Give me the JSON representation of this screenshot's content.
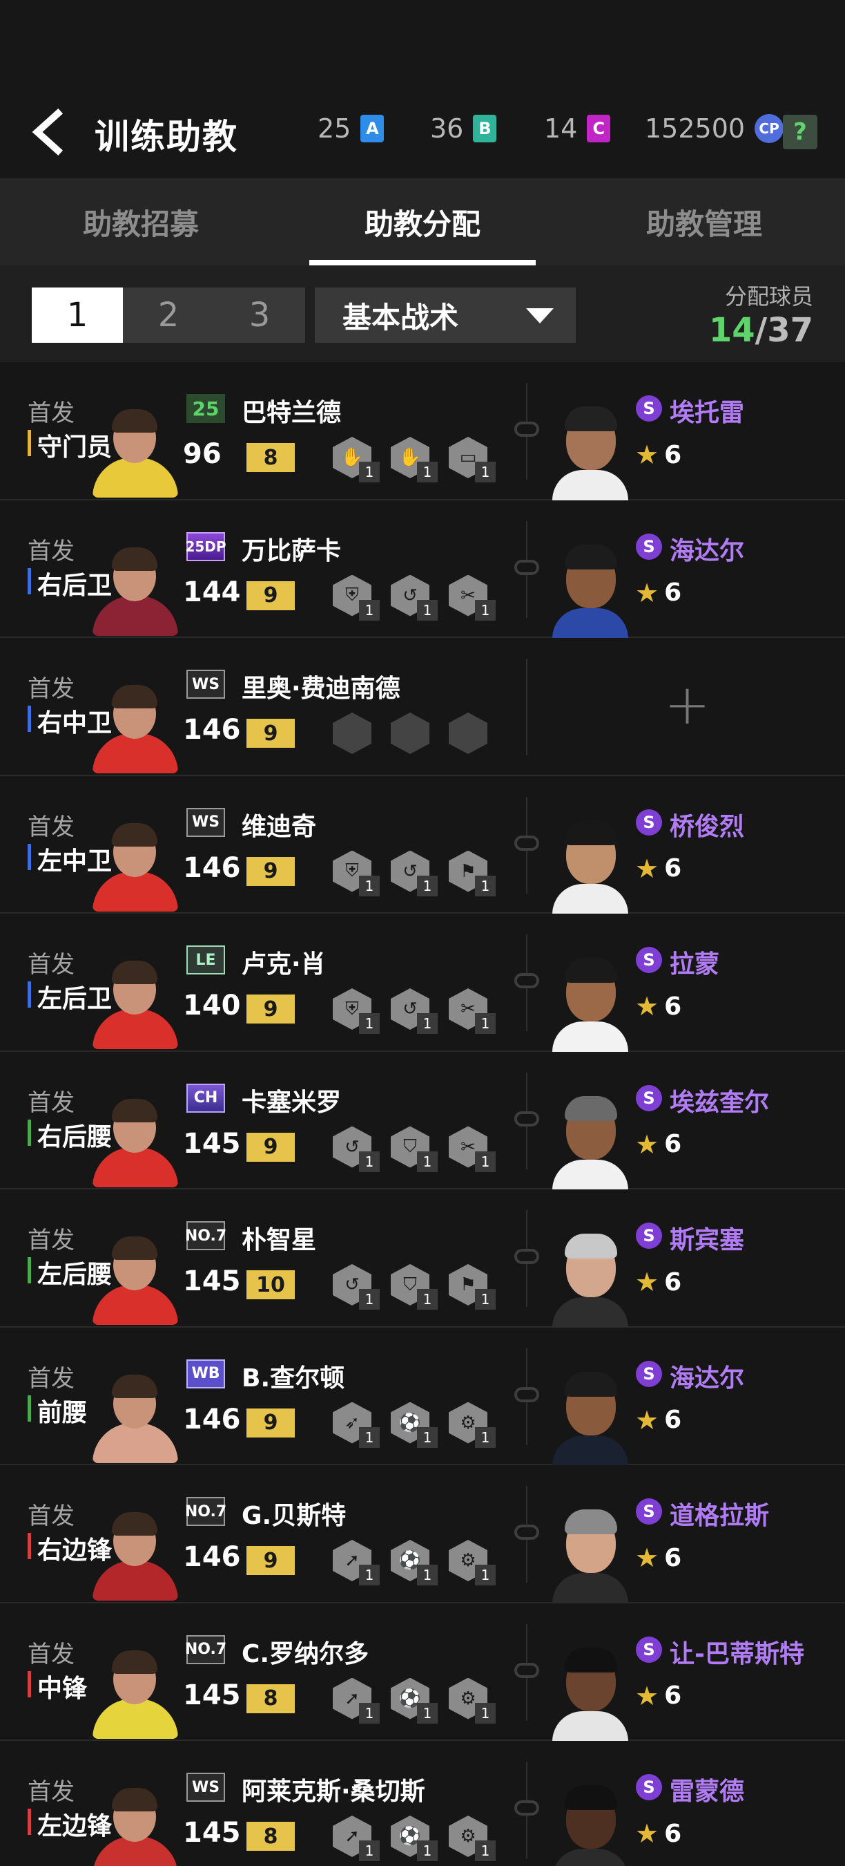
{
  "header": {
    "title": "训练助教",
    "currencies": [
      {
        "value": "25",
        "badge": "A",
        "color": "#2e8de8"
      },
      {
        "value": "36",
        "badge": "B",
        "color": "#2fb39a"
      },
      {
        "value": "14",
        "badge": "C",
        "color": "#c125c6"
      },
      {
        "value": "152500",
        "badge": "CP",
        "color": "#4f6ddd"
      }
    ],
    "help": "?"
  },
  "tabs": [
    {
      "label": "助教招募",
      "active": false
    },
    {
      "label": "助教分配",
      "active": true
    },
    {
      "label": "助教管理",
      "active": false
    }
  ],
  "controls": {
    "segments": [
      "1",
      "2",
      "3"
    ],
    "active_segment": "1",
    "dropdown": "基本战术",
    "assign_label": "分配球员",
    "assigned": "14",
    "total": "/37"
  },
  "rows": [
    {
      "status": "首发",
      "position": "守门员",
      "pos_color": "#e2b43b",
      "badge": "25",
      "badge_style": "green",
      "player": "巴特兰德",
      "rating": "96",
      "level": "8",
      "skills": [
        {
          "icon": "glove-icon",
          "glyph": "✋",
          "num": "1"
        },
        {
          "icon": "hand-icon",
          "glyph": "✋",
          "num": "1"
        },
        {
          "icon": "goal-icon",
          "glyph": "▭",
          "num": "1"
        }
      ],
      "coach": {
        "name": "埃托雷",
        "stars": "6",
        "tier": "S"
      }
    },
    {
      "status": "首发",
      "position": "右后卫",
      "pos_color": "#3e6fe0",
      "badge": "25DP",
      "badge_style": "purple",
      "player": "万比萨卡",
      "rating": "144",
      "level": "9",
      "skills": [
        {
          "icon": "shield-icon",
          "glyph": "⛨",
          "num": "1"
        },
        {
          "icon": "curve-icon",
          "glyph": "↺",
          "num": "1"
        },
        {
          "icon": "tackle-icon",
          "glyph": "✂",
          "num": "1"
        }
      ],
      "coach": {
        "name": "海达尔",
        "stars": "6",
        "tier": "S"
      }
    },
    {
      "status": "首发",
      "position": "右中卫",
      "pos_color": "#3e6fe0",
      "badge": "WS",
      "badge_style": "",
      "player": "里奥·费迪南德",
      "rating": "146",
      "level": "9",
      "skills": [
        {
          "icon": "empty-slot-icon",
          "glyph": "",
          "num": ""
        },
        {
          "icon": "empty-slot-icon",
          "glyph": "",
          "num": ""
        },
        {
          "icon": "empty-slot-icon",
          "glyph": "",
          "num": ""
        }
      ],
      "coach": null,
      "add": "+"
    },
    {
      "status": "首发",
      "position": "左中卫",
      "pos_color": "#3e6fe0",
      "badge": "WS",
      "badge_style": "",
      "player": "维迪奇",
      "rating": "146",
      "level": "9",
      "skills": [
        {
          "icon": "shield-icon",
          "glyph": "⛨",
          "num": "1"
        },
        {
          "icon": "curve-icon",
          "glyph": "↺",
          "num": "1"
        },
        {
          "icon": "header-icon",
          "glyph": "⚑",
          "num": "1"
        }
      ],
      "coach": {
        "name": "桥俊烈",
        "stars": "6",
        "tier": "S"
      }
    },
    {
      "status": "首发",
      "position": "左后卫",
      "pos_color": "#3e6fe0",
      "badge": "LE",
      "badge_style": "le",
      "player": "卢克·肖",
      "rating": "140",
      "level": "9",
      "skills": [
        {
          "icon": "shield-icon",
          "glyph": "⛨",
          "num": "1"
        },
        {
          "icon": "curve-icon",
          "glyph": "↺",
          "num": "1"
        },
        {
          "icon": "tackle-icon",
          "glyph": "✂",
          "num": "1"
        }
      ],
      "coach": {
        "name": "拉蒙",
        "stars": "6",
        "tier": "S"
      }
    },
    {
      "status": "首发",
      "position": "右后腰",
      "pos_color": "#4caa4e",
      "badge": "CH",
      "badge_style": "ch",
      "player": "卡塞米罗",
      "rating": "145",
      "level": "9",
      "skills": [
        {
          "icon": "curve-icon",
          "glyph": "↺",
          "num": "1"
        },
        {
          "icon": "defend-icon",
          "glyph": "⛉",
          "num": "1"
        },
        {
          "icon": "tackle-icon",
          "glyph": "✂",
          "num": "1"
        }
      ],
      "coach": {
        "name": "埃兹奎尔",
        "stars": "6",
        "tier": "S"
      }
    },
    {
      "status": "首发",
      "position": "左后腰",
      "pos_color": "#4caa4e",
      "badge": "NO.7",
      "badge_style": "",
      "player": "朴智星",
      "rating": "145",
      "level": "10",
      "skills": [
        {
          "icon": "curve-icon",
          "glyph": "↺",
          "num": "1"
        },
        {
          "icon": "defend-icon",
          "glyph": "⛉",
          "num": "1"
        },
        {
          "icon": "header-icon",
          "glyph": "⚑",
          "num": "1"
        }
      ],
      "coach": {
        "name": "斯宾塞",
        "stars": "6",
        "tier": "S"
      }
    },
    {
      "status": "首发",
      "position": "前腰",
      "pos_color": "#4caa4e",
      "badge": "WB",
      "badge_style": "wb",
      "player": "B.查尔顿",
      "rating": "146",
      "level": "9",
      "skills": [
        {
          "icon": "kick-icon",
          "glyph": "➶",
          "num": "1"
        },
        {
          "icon": "dribble-icon",
          "glyph": "⚽",
          "num": "1"
        },
        {
          "icon": "finish-icon",
          "glyph": "⚙",
          "num": "1"
        }
      ],
      "coach": {
        "name": "海达尔",
        "stars": "6",
        "tier": "S"
      }
    },
    {
      "status": "首发",
      "position": "右边锋",
      "pos_color": "#d64040",
      "badge": "NO.7",
      "badge_style": "",
      "player": "G.贝斯特",
      "rating": "146",
      "level": "9",
      "skills": [
        {
          "icon": "run-icon",
          "glyph": "➚",
          "num": "1"
        },
        {
          "icon": "dribble-icon",
          "glyph": "⚽",
          "num": "1"
        },
        {
          "icon": "finish-icon",
          "glyph": "⚙",
          "num": "1"
        }
      ],
      "coach": {
        "name": "道格拉斯",
        "stars": "6",
        "tier": "S"
      }
    },
    {
      "status": "首发",
      "position": "中锋",
      "pos_color": "#d64040",
      "badge": "NO.7",
      "badge_style": "",
      "player": "C.罗纳尔多",
      "rating": "145",
      "level": "8",
      "skills": [
        {
          "icon": "run-icon",
          "glyph": "➚",
          "num": "1"
        },
        {
          "icon": "dribble-icon",
          "glyph": "⚽",
          "num": "1"
        },
        {
          "icon": "finish-icon",
          "glyph": "⚙",
          "num": "1"
        }
      ],
      "coach": {
        "name": "让-巴蒂斯特",
        "stars": "6",
        "tier": "S"
      }
    },
    {
      "status": "首发",
      "position": "左边锋",
      "pos_color": "#d64040",
      "badge": "WS",
      "badge_style": "",
      "player": "阿莱克斯·桑切斯",
      "rating": "145",
      "level": "8",
      "skills": [
        {
          "icon": "run-icon",
          "glyph": "➚",
          "num": "1"
        },
        {
          "icon": "ball-icon",
          "glyph": "⚽",
          "num": "1"
        },
        {
          "icon": "finish-icon",
          "glyph": "⚙",
          "num": "1"
        }
      ],
      "coach": {
        "name": "雷蒙德",
        "stars": "6",
        "tier": "S"
      }
    }
  ]
}
